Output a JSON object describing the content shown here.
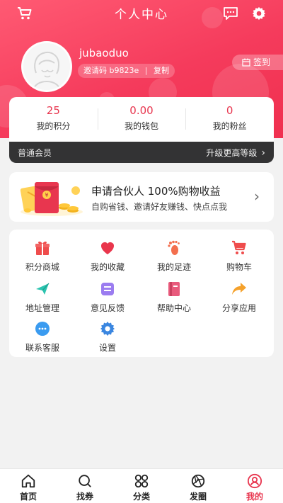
{
  "header": {
    "title": "个人中心",
    "username": "jubaoduo",
    "invite_label": "邀请码",
    "invite_code": "b9823e",
    "copy_label": "复制",
    "signin_label": "签到"
  },
  "stats": [
    {
      "value": "25",
      "label": "我的积分"
    },
    {
      "value": "0.00",
      "label": "我的钱包"
    },
    {
      "value": "0",
      "label": "我的粉丝"
    }
  ],
  "member": {
    "level": "普通会员",
    "upgrade_label": "升级更高等级"
  },
  "promo": {
    "title": "申请合伙人 100%购物收益",
    "subtitle": "自购省钱、邀请好友赚钱、快点点我"
  },
  "menu": [
    {
      "label": "积分商城",
      "icon": "gift-icon"
    },
    {
      "label": "我的收藏",
      "icon": "heart-icon"
    },
    {
      "label": "我的足迹",
      "icon": "footprint-icon"
    },
    {
      "label": "购物车",
      "icon": "cart-icon"
    },
    {
      "label": "地址管理",
      "icon": "location-icon"
    },
    {
      "label": "意见反馈",
      "icon": "feedback-icon"
    },
    {
      "label": "帮助中心",
      "icon": "book-icon"
    },
    {
      "label": "分享应用",
      "icon": "share-icon"
    },
    {
      "label": "联系客服",
      "icon": "chat-icon"
    },
    {
      "label": "设置",
      "icon": "gear-icon"
    }
  ],
  "tabs": [
    {
      "label": "首页",
      "icon": "home-icon"
    },
    {
      "label": "找券",
      "icon": "search-icon"
    },
    {
      "label": "分类",
      "icon": "category-icon"
    },
    {
      "label": "发圈",
      "icon": "aperture-icon"
    },
    {
      "label": "我的",
      "icon": "user-icon",
      "active": true
    }
  ],
  "colors": {
    "brand": "#f53b5c",
    "accent_text": "#e8364f",
    "member_bar": "#333334"
  }
}
